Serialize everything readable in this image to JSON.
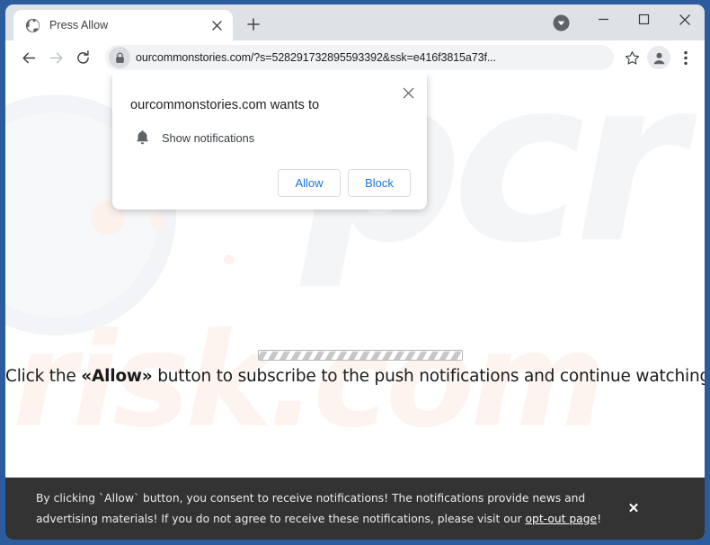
{
  "window": {
    "frame_color": "#2b5c9e",
    "controls": {
      "tab_search_label": "tab-search",
      "minimize_label": "Minimize",
      "maximize_label": "Maximize",
      "close_label": "Close"
    }
  },
  "tab": {
    "title": "Press Allow",
    "favicon": "globe-icon",
    "close_label": "Close tab",
    "new_tab_label": "New tab"
  },
  "toolbar": {
    "back_label": "Back",
    "forward_label": "Forward",
    "reload_label": "Reload",
    "lock_icon": "lock-icon",
    "url": "ourcommonstories.com/?s=528291732895593392&ssk=e416f3815a73f...",
    "bookmark_label": "Bookmark this tab",
    "profile_label": "Profile",
    "menu_label": "Customize and control Google Chrome"
  },
  "dialog": {
    "title": "ourcommonstories.com wants to",
    "permission_icon": "bell-icon",
    "permission_label": "Show notifications",
    "allow_label": "Allow",
    "block_label": "Block",
    "close_label": "Close",
    "allow_color": "#1a73e8"
  },
  "page": {
    "headline_prefix": "Click the ",
    "headline_emphasis": "«Allow»",
    "headline_suffix": " button to subscribe to the push notifications and continue watching",
    "watermark_top": "pcr",
    "watermark_bottom": "risk.com"
  },
  "banner": {
    "line1": "By clicking `Allow` button, you consent to receive notifications! The notifications provide news and advertising",
    "line2_prefix": "materials! If you do not agree to receive these notifications, please visit our ",
    "link_text": "opt-out page",
    "line2_suffix": "!",
    "close_label": "✕",
    "background": "#333333"
  }
}
